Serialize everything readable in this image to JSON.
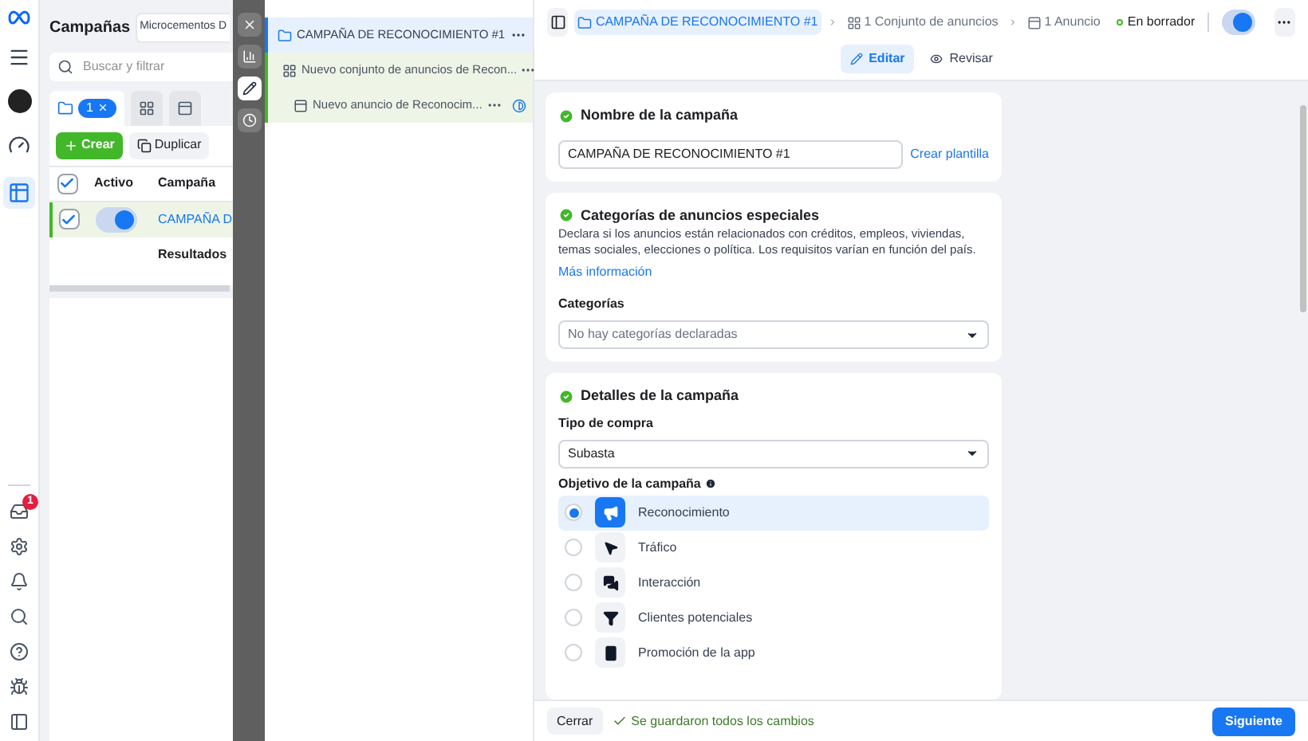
{
  "nav": {
    "top": [
      {
        "kind": "menu",
        "selected": false
      },
      {
        "kind": "avatar",
        "selected": false
      },
      {
        "kind": "gauge",
        "selected": false
      },
      {
        "kind": "table",
        "selected": true
      }
    ],
    "bottom": [
      {
        "kind": "notifications",
        "badge": "1"
      },
      {
        "kind": "settings"
      },
      {
        "kind": "bell"
      },
      {
        "kind": "search"
      },
      {
        "kind": "help"
      },
      {
        "kind": "bug"
      },
      {
        "kind": "panel"
      }
    ]
  },
  "campaigns_panel": {
    "title": "Campañas",
    "account": "Microcementos D",
    "search": {
      "placeholder": "Buscar y filtrar"
    },
    "tabs": [
      {
        "kind": "campaigns",
        "chip": "1",
        "selected": true
      },
      {
        "kind": "adsets",
        "selected": false
      },
      {
        "kind": "ads",
        "selected": false
      }
    ],
    "create_button": "Crear",
    "duplicate_button": "Duplicar",
    "table": {
      "columns": [
        "Activo",
        "Campaña"
      ],
      "header_checked": true,
      "rows": [
        {
          "checked": true,
          "on": true,
          "name": "CAMPAÑA D"
        }
      ],
      "footer": "Resultados"
    }
  },
  "toolbar": [
    {
      "kind": "close",
      "selected": false
    },
    {
      "kind": "chart",
      "selected": false
    },
    {
      "kind": "edit",
      "selected": true
    },
    {
      "kind": "history",
      "selected": false
    }
  ],
  "tree": [
    {
      "kind": "campaign",
      "label": "CAMPAÑA DE RECONOCIMIENTO #1",
      "selected": true
    },
    {
      "kind": "adset",
      "label": "Nuevo conjunto de anuncios de Recon...",
      "selected": false
    },
    {
      "kind": "ad",
      "label": "Nuevo anuncio de Reconocim...",
      "selected": false
    }
  ],
  "header": {
    "breadcrumbs": [
      {
        "kind": "campaign",
        "label": "CAMPAÑA DE RECONOCIMIENTO #1",
        "selected": true
      },
      {
        "kind": "adset",
        "label": "1 Conjunto de anuncios",
        "selected": false
      },
      {
        "kind": "ad",
        "label": "1 Anuncio",
        "selected": false
      }
    ],
    "status": "En borrador",
    "on": true,
    "tabs": [
      {
        "kind": "edit",
        "label": "Editar",
        "selected": true
      },
      {
        "kind": "review",
        "label": "Revisar",
        "selected": false
      }
    ]
  },
  "name_card": {
    "title": "Nombre de la campaña",
    "value": "CAMPAÑA DE RECONOCIMIENTO #1",
    "link": "Crear plantilla"
  },
  "categories_card": {
    "title": "Categorías de anuncios especiales",
    "description": "Declara si los anuncios están relacionados con créditos, empleos, viviendas, temas sociales, elecciones o política. Los requisitos varían en función del país.",
    "link": "Más información",
    "field_label": "Categorías",
    "placeholder": "No hay categorías declaradas"
  },
  "details_card": {
    "title": "Detalles de la campaña",
    "buy_label": "Tipo de compra",
    "buy_value": "Subasta",
    "objective_label": "Objetivo de la campaña",
    "objectives": [
      {
        "kind": "awareness",
        "label": "Reconocimiento",
        "selected": true
      },
      {
        "kind": "traffic",
        "label": "Tráfico",
        "selected": false
      },
      {
        "kind": "engagement",
        "label": "Interacción",
        "selected": false
      },
      {
        "kind": "leads",
        "label": "Clientes potenciales",
        "selected": false
      },
      {
        "kind": "app",
        "label": "Promoción de la app",
        "selected": false
      }
    ]
  },
  "footer": {
    "close_button": "Cerrar",
    "status": "Se guardaron todos los cambios",
    "next_button": "Siguiente"
  }
}
